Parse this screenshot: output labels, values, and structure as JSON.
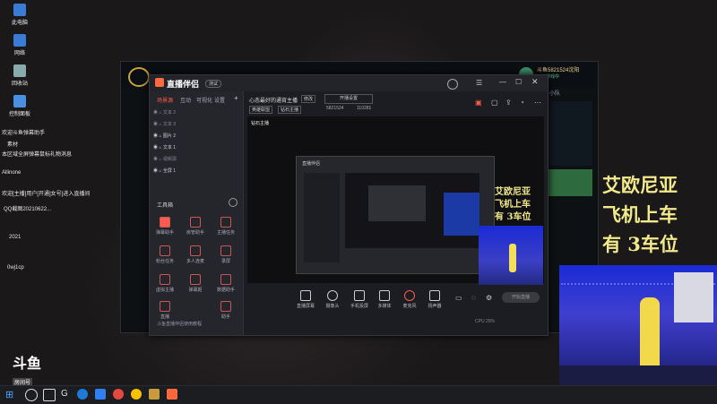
{
  "desktop": {
    "icons": [
      {
        "label": "此电脑"
      },
      {
        "label": "网络"
      },
      {
        "label": "回收站"
      },
      {
        "label": "控制面板"
      }
    ],
    "side_texts": [
      "欢迎斗鱼弹幕助手",
      "素材",
      "本区域全屏弹幕鼠标礼物消息",
      "Allinone",
      "欢迎[主播]用户[开通]女号]进入直播间",
      "QQ截图20210622...",
      "2021",
      "0wj1cp"
    ]
  },
  "game": {
    "right_panel": {
      "line1": "斗鱼5821524沈阳",
      "line2": "正在游戏中",
      "line3": "小队"
    }
  },
  "obs": {
    "app_title": "直播伴侣",
    "version_badge": "测试",
    "left_tabs": [
      "场景源",
      "互动",
      "可视化",
      "设置"
    ],
    "active_tab": "场景源",
    "sources": [
      "文本 2",
      "文本 3",
      "图片 2",
      "文本 1",
      "视频源",
      "全屏 1"
    ],
    "toolbox_title": "工具箱",
    "tools": [
      {
        "label": "弹幕助手"
      },
      {
        "label": "房管助手"
      },
      {
        "label": "主播任务"
      },
      {
        "label": "粉丝任务"
      },
      {
        "label": "多人连麦"
      },
      {
        "label": "录屏"
      },
      {
        "label": "虚拟主播"
      },
      {
        "label": "弹幕姬"
      },
      {
        "label": "数据助手"
      },
      {
        "label": "直播"
      },
      {
        "label": "助手"
      }
    ],
    "notice": "斗鱼直播伴侣使用教程",
    "stream_title": "心态最好的通宵主播",
    "stream_tag": "修改",
    "stream_button": "开播设置",
    "category": "英雄联盟",
    "sub_category": "钻石主播",
    "room_id": "5821524",
    "fans": "110281",
    "bottom_controls": [
      {
        "label": "直播屏幕"
      },
      {
        "label": "摄像头"
      },
      {
        "label": "手机投屏"
      },
      {
        "label": "多媒体"
      },
      {
        "label": "麦克风"
      },
      {
        "label": "扬声器"
      }
    ],
    "start_button": "开始直播",
    "status_text": "CPU 25%"
  },
  "overlay": {
    "lines": [
      "艾欧尼亚",
      "飞机上车",
      "有 3车位"
    ]
  },
  "logo": {
    "name": "斗鱼",
    "sub": "房间号",
    "room": "5821524"
  },
  "colors": {
    "accent": "#ff5a4e",
    "overlay_text": "#f2e98a",
    "taskbar": "#1c1d20"
  }
}
